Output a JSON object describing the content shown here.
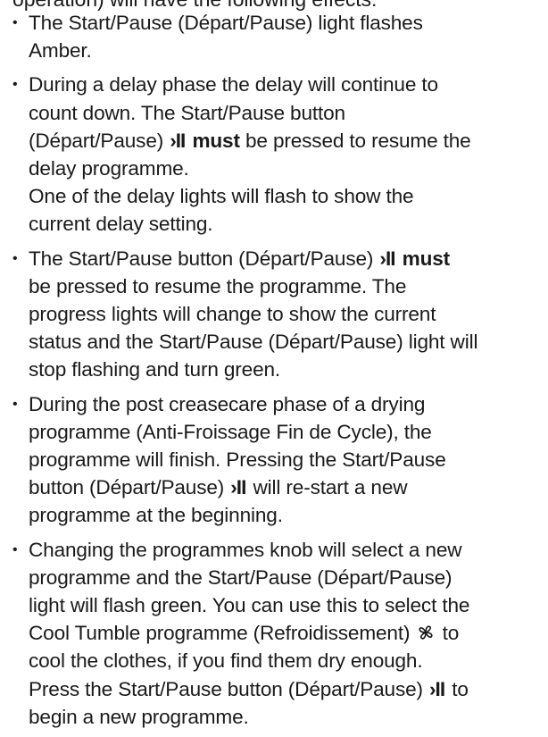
{
  "top_cut_text": "operation) will have the following effects:",
  "startpause_symbol": "›II",
  "bullets": [
    {
      "lines": [
        [
          "The Start/Pause (Départ/Pause) light flashes"
        ],
        [
          "Amber."
        ]
      ]
    },
    {
      "l1": "During a delay phase the delay will continue to",
      "l2": "count down. The Start/Pause button",
      "l3_a": "(Départ/Pause) ",
      "l3_emph": "must",
      "l3_b": " be pressed to resume the",
      "l4": "delay programme.",
      "l5": "One of the delay lights will flash to show the",
      "l6": "current delay setting."
    },
    {
      "l1_a": "The Start/Pause button (Départ/Pause) ",
      "l1_emph": "must",
      "l2": "be pressed to resume the programme. The",
      "l3": "progress lights will change to show the current",
      "l4": "status and the Start/Pause (Départ/Pause) light will",
      "l5": "stop flashing and turn green."
    },
    {
      "l1": "During the post creasecare phase of a drying",
      "l2": "programme (Anti-Froissage Fin de Cycle), the",
      "l3": "programme will finish. Pressing the Start/Pause",
      "l4_a": "button (Départ/Pause) ",
      "l4_b": " will re-start a new",
      "l5": "programme at the beginning."
    },
    {
      "l1": "Changing the programmes knob will select a new",
      "l2": "programme and the Start/Pause (Départ/Pause)",
      "l3": "light will flash green. You can use this to select the",
      "l4_a": "Cool Tumble programme (Refroidissement) ",
      "l4_b": " to",
      "l5": "cool the clothes, if you find them dry enough.",
      "l6_a": "Press the Start/Pause button (Départ/Pause) ",
      "l6_b": " to",
      "l7": "begin a new programme."
    }
  ]
}
